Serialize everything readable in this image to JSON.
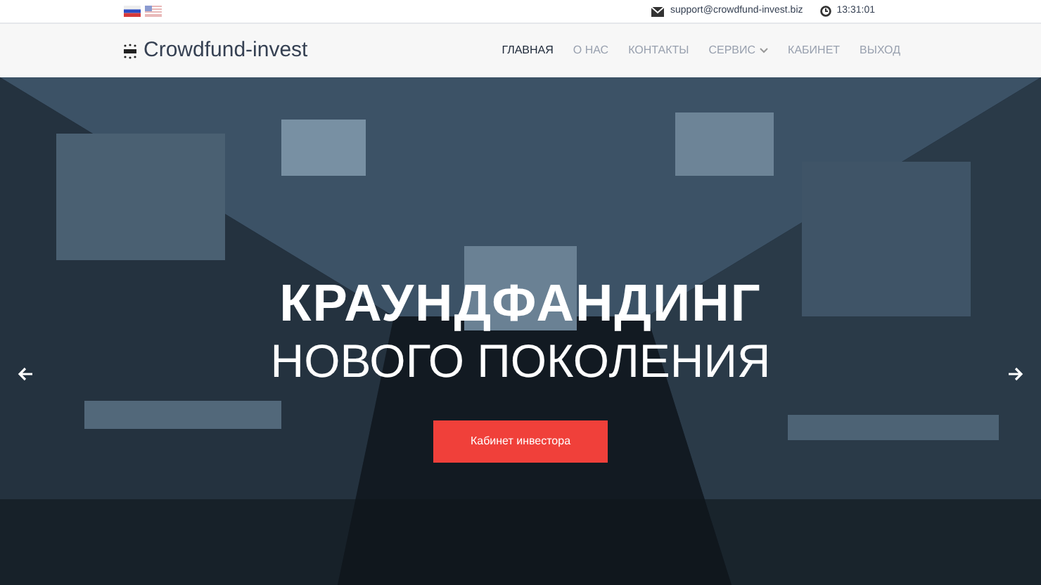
{
  "top_bar": {
    "languages": [
      {
        "kind": "ru"
      },
      {
        "kind": "us"
      }
    ],
    "email": "support@crowdfund-invest.biz",
    "time": "13:31:01"
  },
  "header": {
    "logo": "Crowdfund-invest",
    "nav": [
      {
        "label": "ГЛАВНАЯ",
        "selected": true
      },
      {
        "label": "О НАС",
        "selected": false
      },
      {
        "label": "КОНТАКТЫ",
        "selected": false
      },
      {
        "label": "СЕРВИС",
        "selected": false,
        "dropdown": true
      },
      {
        "label": "КАБИНЕТ",
        "selected": false
      },
      {
        "label": "ВЫХОД",
        "selected": false
      }
    ]
  },
  "hero": {
    "title": "КРАУНДФАНДИНГ",
    "subtitle": "НОВОГО ПОКОЛЕНИЯ",
    "button": "Кабинет инвестора"
  }
}
